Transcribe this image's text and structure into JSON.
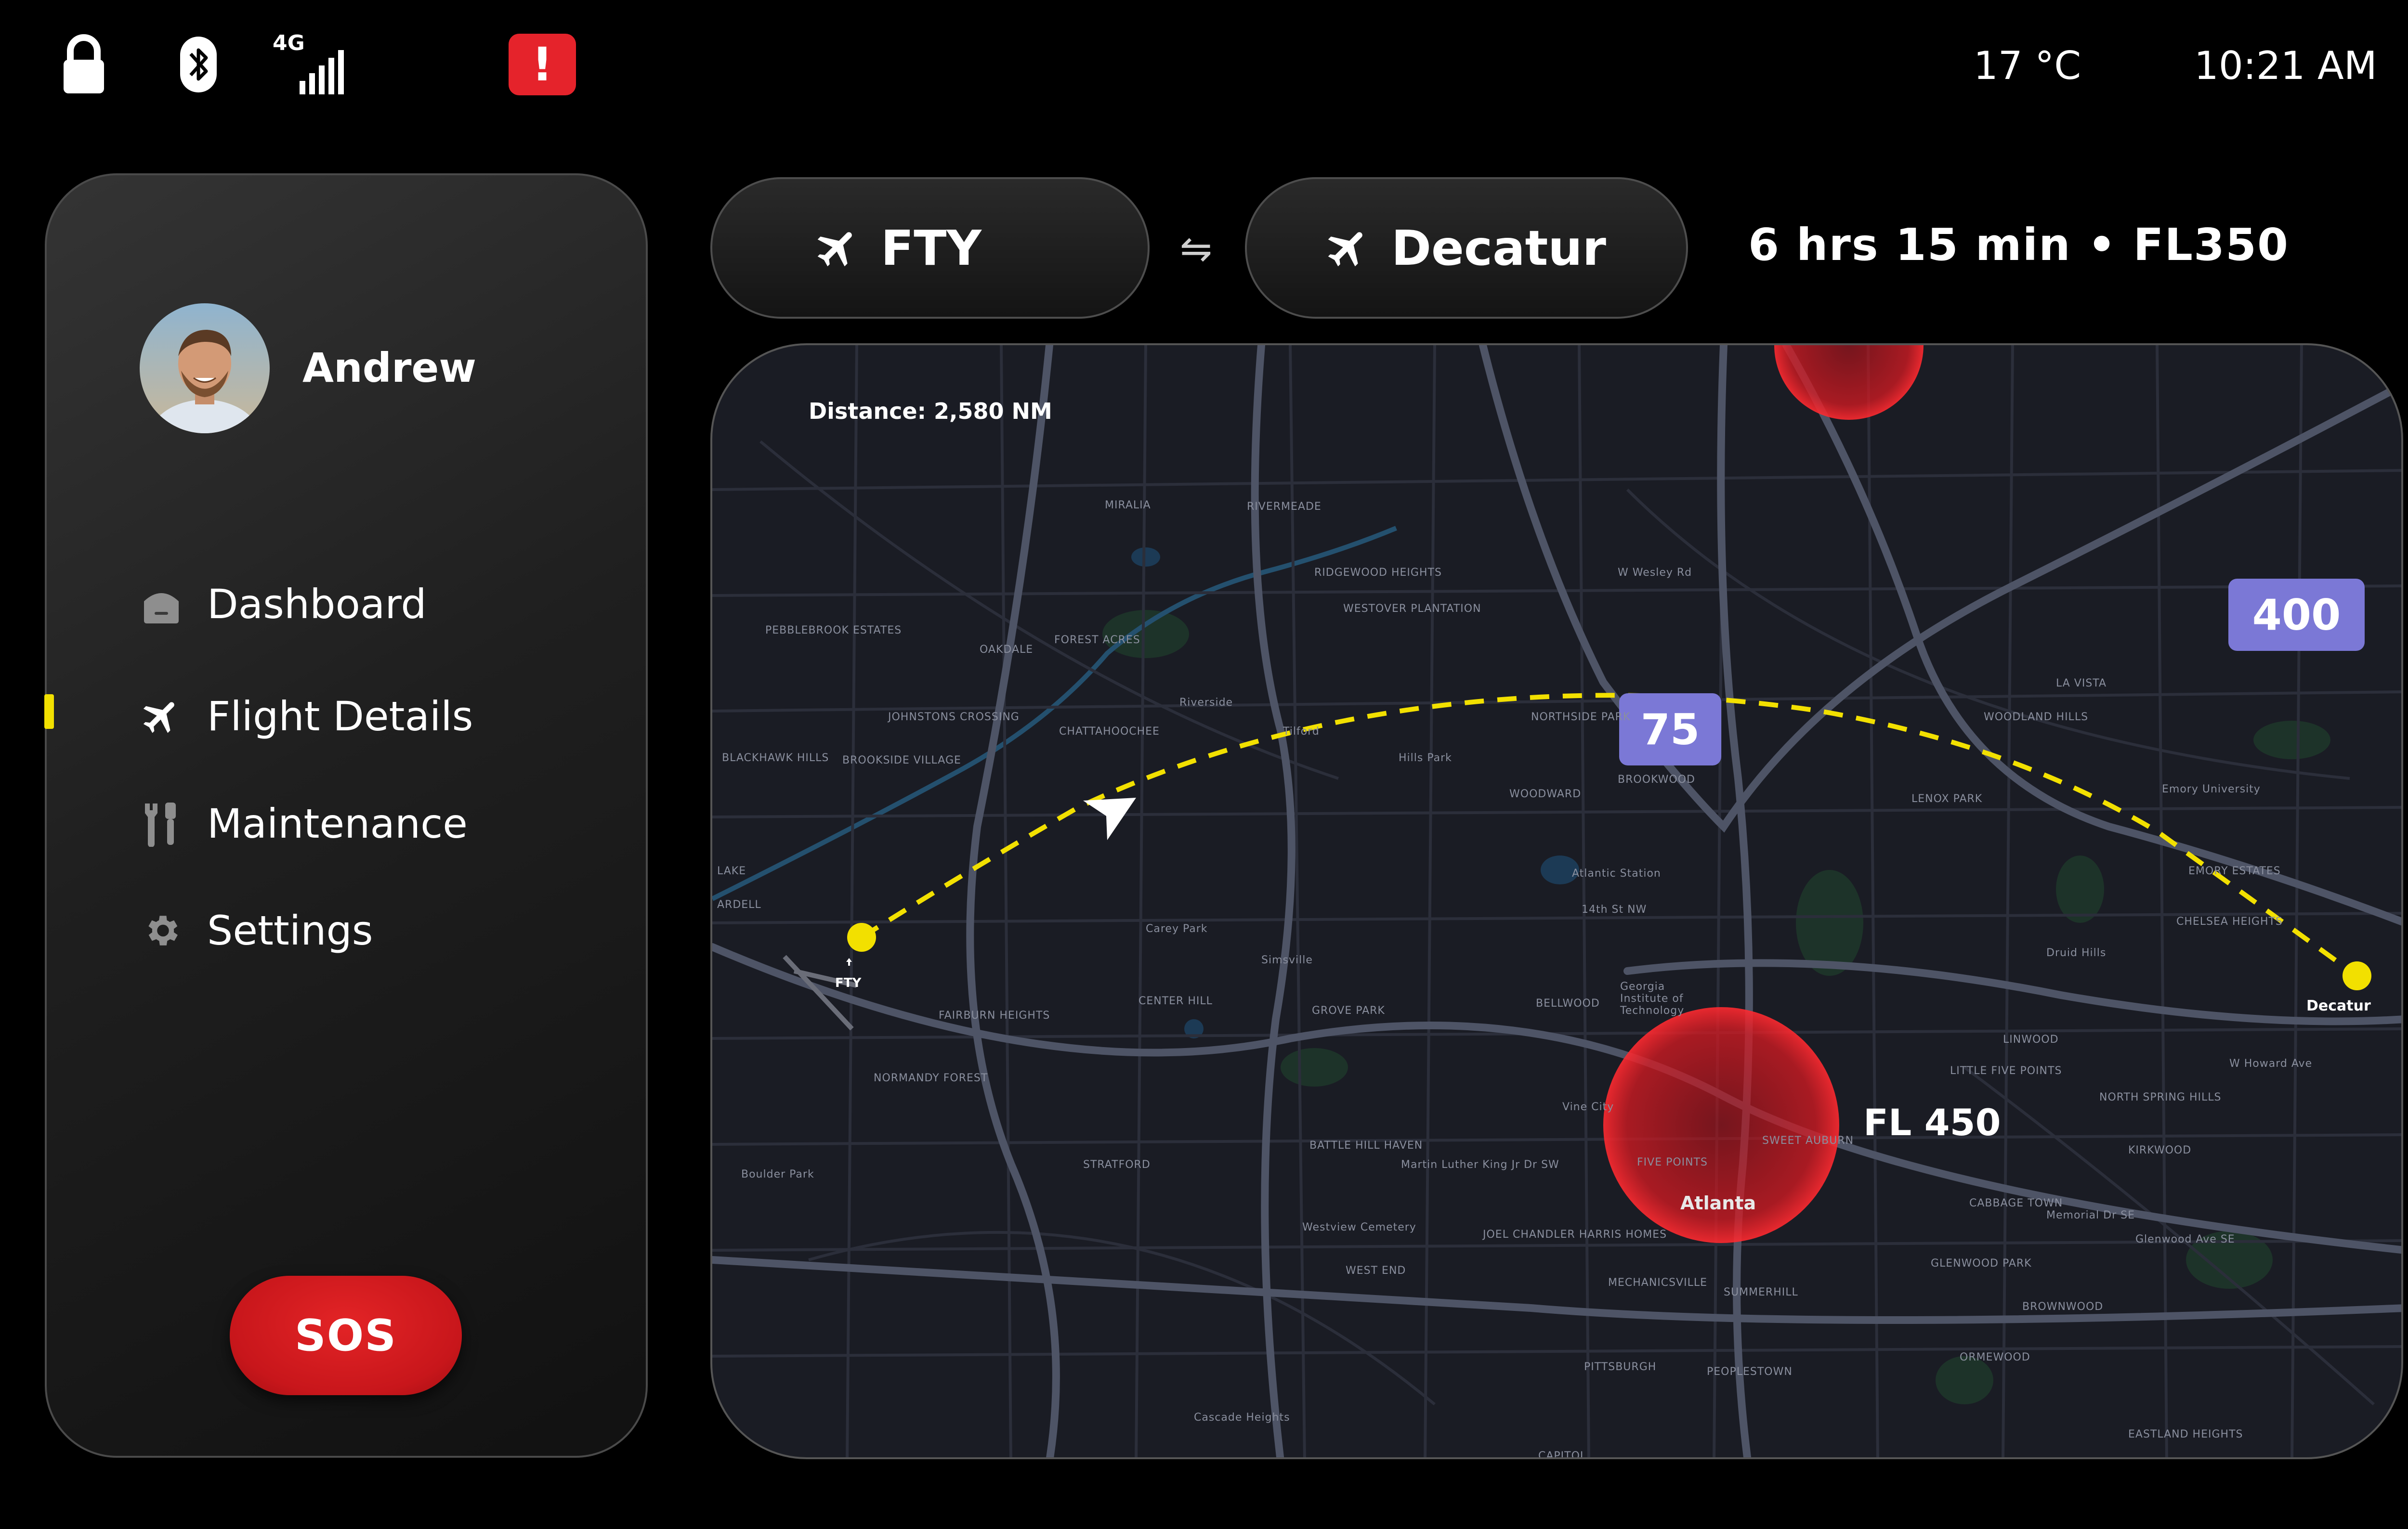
{
  "status": {
    "network": "4G",
    "alert_symbol": "!",
    "temperature": "17 °C",
    "time": "10:21 AM"
  },
  "sidebar": {
    "user_name": "Andrew",
    "nav": [
      {
        "label": "Dashboard",
        "icon": "home-icon"
      },
      {
        "label": "Flight Details",
        "icon": "airplane-icon",
        "active": true
      },
      {
        "label": "Maintenance",
        "icon": "wrench-screwdriver-icon"
      },
      {
        "label": "Settings",
        "icon": "gear-icon"
      }
    ],
    "sos_label": "SOS"
  },
  "route": {
    "origin": "FTY",
    "destination": "Decatur",
    "swap_symbol": "⇋",
    "summary": "6 hrs 15 min • FL350"
  },
  "map": {
    "distance": "Distance: 2,580 NM",
    "altitude_badges": [
      "75",
      "400"
    ],
    "restricted_zone_label": "FL 450",
    "origin_code": "FTY",
    "destination_label": "Decatur",
    "city_label": "Atlanta",
    "places": [
      "MIRALIA",
      "RIVERMEADE",
      "RIDGEWOOD HEIGHTS",
      "WESTOVER PLANTATION",
      "PEBBLEBROOK ESTATES",
      "OAKDALE",
      "FOREST ACRES",
      "Riverside",
      "JOHNSTONS CROSSING",
      "CHATTAHOOCHEE",
      "Tilford",
      "Hills Park",
      "BLACKHAWK HILLS",
      "BROOKSIDE VILLAGE",
      "NORTHSIDE PARK",
      "BROOKWOOD",
      "WOODWARD",
      "LA VISTA",
      "WOODLAND HILLS",
      "LENOX PARK",
      "Emory University",
      "EMORY ESTATES",
      "CHELSEA HEIGHTS",
      "Druid Hills",
      "Atlantic Station",
      "14th St NW",
      "Carey Park",
      "Simsville",
      "CENTER HILL",
      "GROVE PARK",
      "BELLWOOD",
      "Georgia Institute of Technology",
      "FAIRBURN HEIGHTS",
      "NORMANDY FOREST",
      "LINWOOD",
      "LITTLE FIVE POINTS",
      "NORTH SPRING HILLS",
      "Vine City",
      "FIVE POINTS",
      "SWEET AUBURN",
      "BATTLE HILL HAVEN",
      "STRATFORD",
      "KIRKWOOD",
      "CABBAGE TOWN",
      "Boulder Park",
      "Westview Cemetery",
      "JOEL CHANDLER HARRIS HOMES",
      "WEST END",
      "MECHANICSVILLE",
      "SUMMERHILL",
      "GLENWOOD PARK",
      "BROWNWOOD",
      "ORMEWOOD",
      "PITTSBURGH",
      "PEOPLESTOWN",
      "Cascade Heights",
      "EASTLAND HEIGHTS",
      "CAPITOL",
      "W Wesley Rd",
      "Memorial Dr SE",
      "Glenwood Ave SE",
      "LAKE",
      "ARDELL",
      "Martin Luther King Jr Dr SW",
      "W Howard Ave"
    ]
  },
  "colors": {
    "accent_yellow": "#f2e000",
    "alert_red": "#e5232b",
    "badge_purple": "#7b78d6",
    "map_bg": "#1a1c24"
  }
}
